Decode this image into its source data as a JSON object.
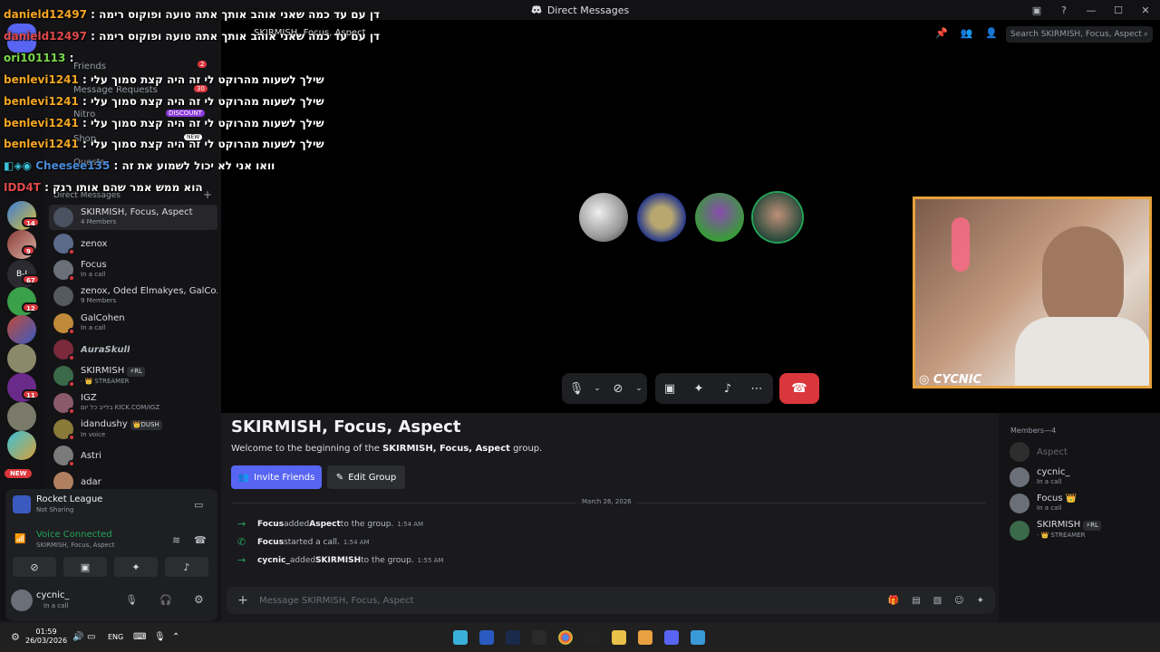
{
  "window": {
    "title": "Direct Messages"
  },
  "nav": {
    "friends": "Friends",
    "friends_badge": "2",
    "requests": "Message Requests",
    "requests_badge": "30",
    "nitro": "Nitro",
    "nitro_badge": "DISCOUNT",
    "shop": "Shop",
    "shop_badge": "NEW",
    "quests": "Quests",
    "dm_header": "Direct Messages"
  },
  "server_badges": [
    "14",
    "9",
    "67",
    "12",
    "11"
  ],
  "new_badge": "NEW",
  "dms": [
    {
      "name": "SKIRMISH, Focus, Aspect",
      "sub": "4 Members",
      "color": "#4a5160"
    },
    {
      "name": "zenox",
      "sub": "",
      "color": "#5c6a8a"
    },
    {
      "name": "Focus",
      "sub": "In a call",
      "color": "#6a6f78"
    },
    {
      "name": "zenox, Oded Elmakyes, GalCo...",
      "sub": "9 Members",
      "color": "#555a60"
    },
    {
      "name": "GalCohen",
      "sub": "In a call",
      "color": "#c08a3a"
    },
    {
      "name": "AuraSkull",
      "sub": "",
      "color": "#7a2a3a"
    },
    {
      "name": "SKIRMISH",
      "sub": "· 👑 STREAMER",
      "tag": "⚡RL",
      "color": "#3a6a4a"
    },
    {
      "name": "IGZ",
      "sub": "בלייב כל יום KICK.COM/IGZ",
      "color": "#8a5a6a"
    },
    {
      "name": "idandushy",
      "sub": "In voice",
      "tag": "👑DUSH",
      "color": "#8a7a3a"
    },
    {
      "name": "Astri",
      "sub": "",
      "color": "#7a7a7a"
    },
    {
      "name": "adar",
      "sub": "",
      "color": "#b08060"
    }
  ],
  "panel": {
    "game": "Rocket League",
    "game_sub": "Not Sharing",
    "voice": "Voice Connected",
    "voice_sub": "SKIRMISH, Focus, Aspect",
    "user": "cycnic_",
    "user_sub": "In a call"
  },
  "call": {
    "header": "SKIRMISH, Focus, Aspect",
    "search_placeholder": "Search SKIRMISH, Focus, Aspect",
    "cam_label": "CYCNIC"
  },
  "chat": {
    "title": "SKIRMISH, Focus, Aspect",
    "welcome_pre": "Welcome to the beginning of the ",
    "welcome_bold": "SKIRMISH, Focus, Aspect",
    "welcome_post": " group.",
    "invite_label": "Invite Friends",
    "edit_label": "Edit Group",
    "date": "March 26, 2026",
    "messages": [
      {
        "a": "Focus",
        "mid": " added ",
        "b": "Aspect",
        "end": " to the group.",
        "ts": "1:54 AM",
        "icon": "→"
      },
      {
        "a": "Focus",
        "mid": " started a call.",
        "b": "",
        "end": "",
        "ts": "1:54 AM",
        "icon": "✆"
      },
      {
        "a": "cycnic_",
        "mid": " added ",
        "b": "SKIRMISH",
        "end": " to the group.",
        "ts": "1:55 AM",
        "icon": "→"
      }
    ],
    "input_placeholder": "Message SKIRMISH, Focus, Aspect"
  },
  "members": {
    "header": "Members—4",
    "list": [
      {
        "name": "Aspect",
        "sub": "",
        "color": "#555"
      },
      {
        "name": "cycnic_",
        "sub": "In a call",
        "color": "#6a6f78"
      },
      {
        "name": "Focus 👑",
        "sub": "In a call",
        "color": "#6a6f78"
      },
      {
        "name": "SKIRMISH",
        "sub": "· 👑 STREAMER",
        "tag": "⚡RL",
        "color": "#3a6a4a"
      }
    ]
  },
  "overlay_chat": [
    {
      "user": "danield12497",
      "msg": ": דן עם עד כמה שאני אוהב אותך אתה טועה ופוקוס רימה"
    },
    {
      "user": "danield12497",
      "msg": ": דן עם עד כמה שאני אוהב אותך אתה טועה ופוקוס רימה"
    },
    {
      "user": "ori101113",
      "msg": ":"
    },
    {
      "user": "benlevi1241",
      "msg": ": שילך לשעות מהרוקט לי זה היה קצת סמוך עלי"
    },
    {
      "user": "benlevi1241",
      "msg": ": שילך לשעות מהרוקט לי זה היה קצת סמוך עלי"
    },
    {
      "user": "benlevi1241",
      "msg": ": שילך לשעות מהרוקט לי זה היה קצת סמוך עלי"
    },
    {
      "user": "benlevi1241",
      "msg": ": שילך לשעות מהרוקט לי זה היה קצת סמוך עלי"
    },
    {
      "user": "Cheesee135",
      "msg": ": וואו אני לא יכול לשמוע את זה"
    },
    {
      "user": "IDD4T",
      "msg": ": הוא ממש אמר שהם אותו רנק"
    }
  ],
  "taskbar": {
    "time": "01:59",
    "date": "26/03/2026",
    "lang": "ENG"
  }
}
